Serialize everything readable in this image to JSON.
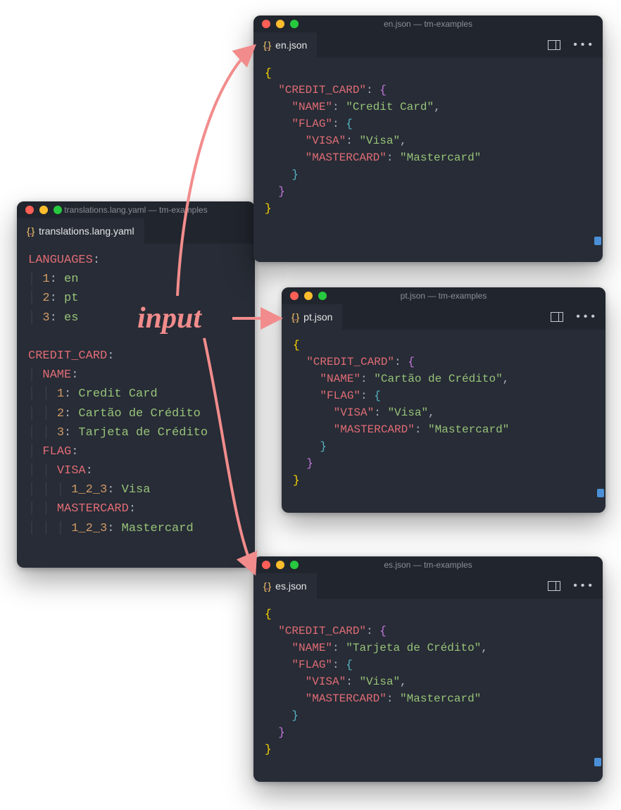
{
  "label": {
    "input": "input"
  },
  "source": {
    "titlebar": "translations.lang.yaml — tm-examples",
    "tab": "translations.lang.yaml",
    "code_html": "<span class='k-key'>LANGUAGES</span><span class='k-pun'>:</span>\n<span class='k-guide'>│ </span><span class='k-num'>1</span><span class='k-pun'>:</span> <span class='k-str'>en</span>\n<span class='k-guide'>│ </span><span class='k-num'>2</span><span class='k-pun'>:</span> <span class='k-str'>pt</span>\n<span class='k-guide'>│ </span><span class='k-num'>3</span><span class='k-pun'>:</span> <span class='k-str'>es</span>\n\n<span class='k-key'>CREDIT_CARD</span><span class='k-pun'>:</span>\n<span class='k-guide'>│ </span><span class='k-key'>NAME</span><span class='k-pun'>:</span>\n<span class='k-guide'>│ │ </span><span class='k-num'>1</span><span class='k-pun'>:</span> <span class='k-str'>Credit Card</span>\n<span class='k-guide'>│ │ </span><span class='k-num'>2</span><span class='k-pun'>:</span> <span class='k-str'>Cartão de Crédito</span>\n<span class='k-guide'>│ │ </span><span class='k-num'>3</span><span class='k-pun'>:</span> <span class='k-str'>Tarjeta de Crédito</span>\n<span class='k-guide'>│ </span><span class='k-key'>FLAG</span><span class='k-pun'>:</span>\n<span class='k-guide'>│ │ </span><span class='k-key'>VISA</span><span class='k-pun'>:</span>\n<span class='k-guide'>│ │ │ </span><span class='k-num'>1_2_3</span><span class='k-pun'>:</span> <span class='k-str'>Visa</span>\n<span class='k-guide'>│ │ </span><span class='k-key'>MASTERCARD</span><span class='k-pun'>:</span>\n<span class='k-guide'>│ │ │ </span><span class='k-num'>1_2_3</span><span class='k-pun'>:</span> <span class='k-str'>Mastercard</span>"
  },
  "outputs": [
    {
      "id": "en",
      "titlebar": "en.json — tm-examples",
      "tab": "en.json",
      "name_value": "Credit Card"
    },
    {
      "id": "pt",
      "titlebar": "pt.json — tm-examples",
      "tab": "pt.json",
      "name_value": "Cartão de Crédito"
    },
    {
      "id": "es",
      "titlebar": "es.json — tm-examples",
      "tab": "es.json",
      "name_value": "Tarjeta de Crédito"
    }
  ],
  "json_shared": {
    "top_key": "CREDIT_CARD",
    "name_key": "NAME",
    "flag_key": "FLAG",
    "visa_key": "VISA",
    "visa_val": "Visa",
    "mc_key": "MASTERCARD",
    "mc_val": "Mastercard"
  }
}
